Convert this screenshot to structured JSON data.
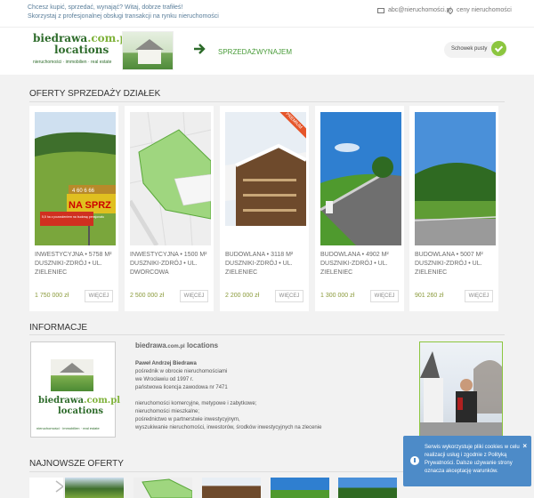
{
  "topbar": {
    "tagline_1": "Chcesz kupić, sprzedać, wynająć? Witaj, dobrze trafiłeś!",
    "tagline_2": "Skorzystaj z profesjonalnej obsługi transakcji na rynku nieruchomości",
    "email": "abc@nieruchomości.pl",
    "prices_link": "ceny nieruchomości"
  },
  "header": {
    "logo_brand": "biedrawa",
    "logo_tld": ".com.pl",
    "logo_sub": "locations",
    "logo_tag": "nieruchomości · immobilien · real estate",
    "nav_sell": "SPRZEDAŻ",
    "nav_rent": "WYNAJEM",
    "clipboard_label": "Schowek pusty"
  },
  "offers": {
    "title": "OFERTY SPRZEDAŻY DZIAŁEK",
    "more_label": "WIĘCEJ",
    "items": [
      {
        "type": "INWESTYCYJNA",
        "area": "5758 M²",
        "location": "DUSZNIKI-ZDRÓJ • UL. ZIELENIEC",
        "price": "1 750 000 zł",
        "sign_text": "NA SPRZ",
        "sign_area": "4 60 6 66",
        "sign_note": "5,5 ha z pozwoleniem na budowę pensjonatu"
      },
      {
        "type": "INWESTYCYJNA",
        "area": "1500 M²",
        "location": "DUSZNIKI-ZDRÓJ • UL. DWORCOWA",
        "price": "2 500 000 zł"
      },
      {
        "type": "BUDOWLANA",
        "area": "3118 M²",
        "location": "DUSZNIKI-ZDRÓJ • UL. ZIELENIEC",
        "price": "2 200 000 zł",
        "badge": "PREMIUM"
      },
      {
        "type": "BUDOWLANA",
        "area": "4902 M²",
        "location": "DUSZNIKI-ZDRÓJ • UL. ZIELENIEC",
        "price": "1 300 000 zł"
      },
      {
        "type": "BUDOWLANA",
        "area": "5007 M²",
        "location": "DUSZNIKI-ZDRÓJ • UL. ZIELENIEC",
        "price": "901 260 zł"
      }
    ]
  },
  "info": {
    "title": "INFORMACJE",
    "company": "biedrawa",
    "company_tld": ".com.pl",
    "company_sub": "locations",
    "person": "Paweł Andrzej Biedrawa",
    "lines_1": [
      "pośrednik w obrocie nieruchomościami",
      "we Wrocławiu od 1997 r.",
      "państwowa licencja zawodowa nr 7471"
    ],
    "lines_2": [
      "nieruchomości komercyjne, metypowe i zabytkowe;",
      "nieruchomości mieszkalne;",
      "pośrednictwo w partnerstwie inwestycyjnym,",
      "wyszukiwanie nieruchomości, inwestorów, środków inwestycyjnych na zlecenie"
    ]
  },
  "newest": {
    "title": "NAJNOWSZE OFERTY"
  },
  "cookie": {
    "message": "Serwis wykorzystuje pliki cookies w celu realizacji usług i zgodnie z Polityką Prywatności. Dalsze używanie strony oznacza akceptację warunków.",
    "close": "×"
  },
  "colors": {
    "accent_green": "#8cc63f",
    "price_olive": "#8a9a3a",
    "cookie_blue": "#4d8bc8",
    "premium_orange": "#e5552a"
  }
}
